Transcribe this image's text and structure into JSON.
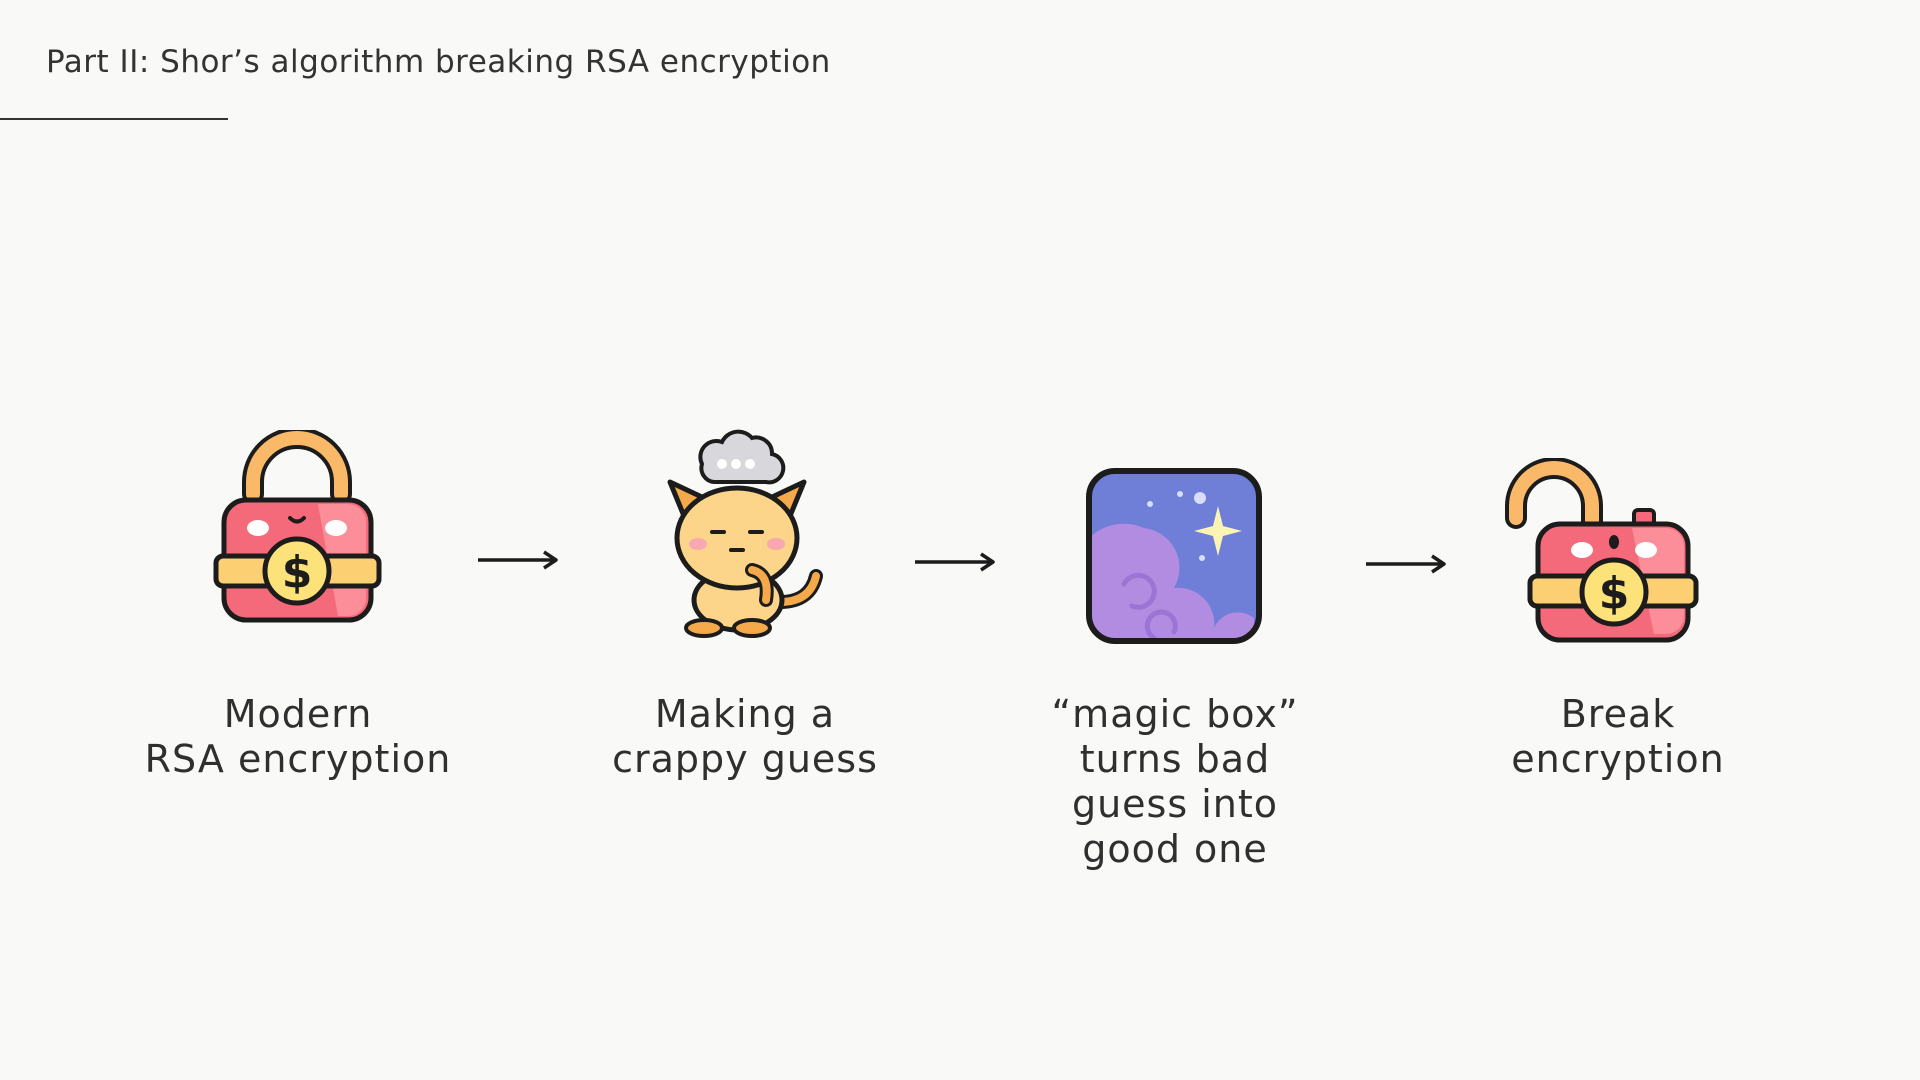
{
  "slide": {
    "title": "Part II: Shor’s algorithm breaking RSA encryption"
  },
  "steps": [
    {
      "icon": "locked-padlock-icon",
      "label_lines": [
        "Modern",
        "RSA encryption"
      ]
    },
    {
      "icon": "thinking-cat-icon",
      "label_lines": [
        "Making a",
        "crappy guess"
      ]
    },
    {
      "icon": "magic-box-icon",
      "label_lines": [
        "“magic box”",
        "turns bad",
        "guess into",
        "good one"
      ]
    },
    {
      "icon": "unlocked-padlock-icon",
      "label_lines": [
        "Break",
        "encryption"
      ]
    }
  ],
  "colors": {
    "lock_body": "#f56a7a",
    "lock_shackle": "#f9b968",
    "lock_band": "#fbcf72",
    "coin": "#fde27a",
    "cat_fur": "#fcd58a",
    "cat_stripe": "#f4a94a",
    "box_sky": "#6f7fd8",
    "box_cloud": "#b28ce0",
    "outline": "#1c1c1c"
  }
}
